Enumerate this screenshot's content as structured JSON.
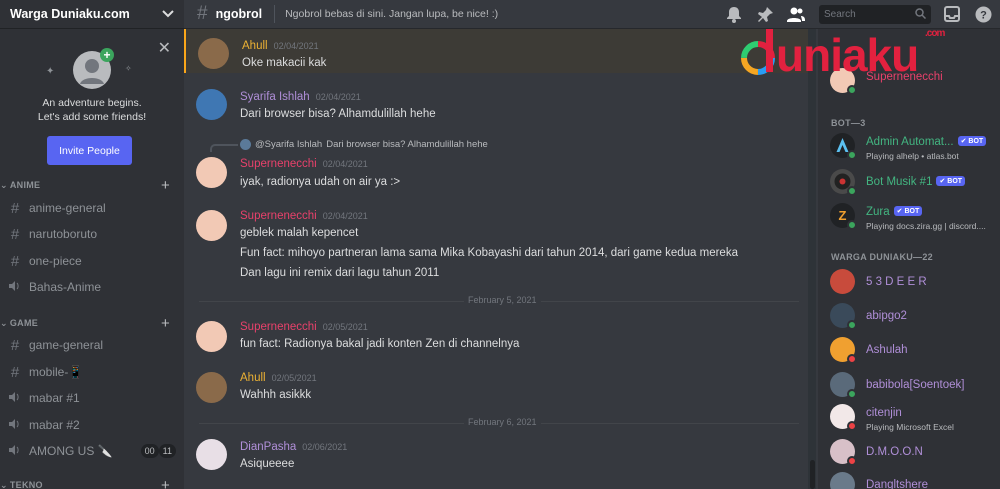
{
  "server": {
    "name": "Warga Duniaku.com"
  },
  "friends_card": {
    "line1": "An adventure begins.",
    "line2": "Let's add some friends!",
    "invite_label": "Invite People"
  },
  "categories": [
    {
      "name": "ANIME",
      "channels": [
        {
          "type": "text",
          "name": "anime-general"
        },
        {
          "type": "text",
          "name": "narutoboruto"
        },
        {
          "type": "text",
          "name": "one-piece"
        },
        {
          "type": "voice",
          "name": "Bahas-Anime"
        }
      ]
    },
    {
      "name": "GAME",
      "channels": [
        {
          "type": "text",
          "name": "game-general"
        },
        {
          "type": "text",
          "name": "mobile-📱"
        },
        {
          "type": "voice",
          "name": "mabar #1"
        },
        {
          "type": "voice",
          "name": "mabar #2"
        },
        {
          "type": "voice",
          "name": "AMONG US 🔪",
          "badge_a": "00",
          "badge_b": "11"
        }
      ]
    },
    {
      "name": "TEKNO",
      "channels": []
    }
  ],
  "topbar": {
    "channel": "ngobrol",
    "topic": "Ngobrol bebas di sini. Jangan lupa, be nice! :)",
    "search_placeholder": "Search",
    "icons": [
      "bell-icon",
      "pin-icon",
      "members-icon",
      "inbox-icon",
      "help-icon"
    ]
  },
  "messages": [
    {
      "author": "Ahull",
      "time": "02/04/2021",
      "color": "#ebb134",
      "lines": [
        "Oke makacii kak"
      ],
      "highlight": true
    },
    {
      "author": "Syarifa Ishlah",
      "time": "02/04/2021",
      "color": "#b08fd8",
      "lines": [
        "Dari browser bisa? Alhamdulillah hehe"
      ]
    },
    {
      "author": "Supernenecchi",
      "time": "02/04/2021",
      "color": "#e8416b",
      "reply_author": "@Syarifa Ishlah",
      "reply_text": "Dari browser bisa? Alhamdulillah hehe",
      "lines": [
        "iyak, radionya udah on air ya :>"
      ]
    },
    {
      "author": "Supernenecchi",
      "time": "02/04/2021",
      "color": "#e8416b",
      "lines": [
        "geblek malah kepencet",
        "Fun fact: mihoyo partneran lama sama Mika Kobayashi dari tahun 2014, dari game kedua mereka",
        "Dan lagu ini remix dari lagu tahun 2011"
      ]
    },
    {
      "author": "Supernenecchi",
      "time": "02/05/2021",
      "color": "#e8416b",
      "lines": [
        "fun fact: Radionya bakal jadi konten Zen di channelnya"
      ]
    },
    {
      "author": "Ahull",
      "time": "02/05/2021",
      "color": "#ebb134",
      "lines": [
        "Wahhh asikkk"
      ]
    },
    {
      "author": "DianPasha",
      "time": "02/06/2021",
      "color": "#b08fd8",
      "lines": [
        "Asiqueeee"
      ]
    }
  ],
  "date_separators": [
    "February 5, 2021",
    "February 6, 2021"
  ],
  "members": {
    "top_member": {
      "name": "Supernenecchi",
      "color": "#e8416b"
    },
    "bot_header": "BOT—3",
    "bots": [
      {
        "name": "Admin Automat...",
        "badge": "✔ BOT",
        "status": "Playing alhelp • atlas.bot",
        "color": "#43b581"
      },
      {
        "name": "Bot Musik #1",
        "badge": "✔ BOT",
        "status": "",
        "color": "#43b581"
      },
      {
        "name": "Zura",
        "badge": "✔ BOT",
        "status": "Playing docs.zira.gg | discord....",
        "color": "#43b581"
      }
    ],
    "group_header": "WARGA DUNIAKU—22",
    "list": [
      {
        "name": "5 3 D E E R",
        "status": "",
        "color": "#b08fd8"
      },
      {
        "name": "abipgo2",
        "status": "",
        "color": "#b08fd8"
      },
      {
        "name": "Ashulah",
        "status": "",
        "color": "#b08fd8"
      },
      {
        "name": "babibola[Soentoek]",
        "status": "",
        "color": "#b08fd8"
      },
      {
        "name": "citenjin",
        "status": "Playing Microsoft Excel",
        "color": "#b08fd8"
      },
      {
        "name": "D.M.O.O.N",
        "status": "",
        "color": "#b08fd8"
      },
      {
        "name": "Dangltshere",
        "status": "",
        "color": "#b08fd8"
      }
    ]
  },
  "logo": {
    "text": "duniaku",
    "suffix": ".com",
    "color": "#e2213f"
  }
}
